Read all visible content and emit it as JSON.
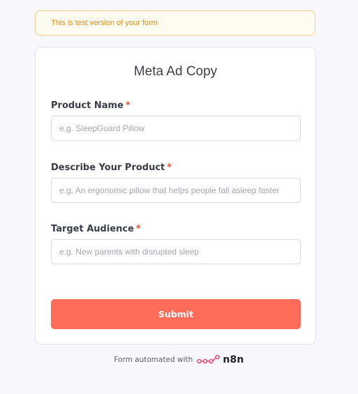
{
  "banner": {
    "text": "This is test version of your form"
  },
  "form": {
    "title": "Meta Ad Copy",
    "fields": [
      {
        "label": "Product Name",
        "required_mark": "*",
        "value": "",
        "placeholder": "e.g. SleepGuard Pillow"
      },
      {
        "label": "Describe Your Product",
        "required_mark": "*",
        "value": "",
        "placeholder": "e.g. An ergonomic pillow that helps people fall asleep faster"
      },
      {
        "label": "Target Audience",
        "required_mark": "*",
        "value": "",
        "placeholder": "e.g. New parents with disrupted sleep"
      }
    ],
    "submit_label": "Submit"
  },
  "footer": {
    "text": "Form automated with",
    "brand_name": "n8n",
    "brand_icon": "n8n-logo-icon",
    "brand_color": "#ea4b71"
  },
  "colors": {
    "accent": "#ff6d5a",
    "required": "#e5533d",
    "banner_text": "#e58c15"
  }
}
